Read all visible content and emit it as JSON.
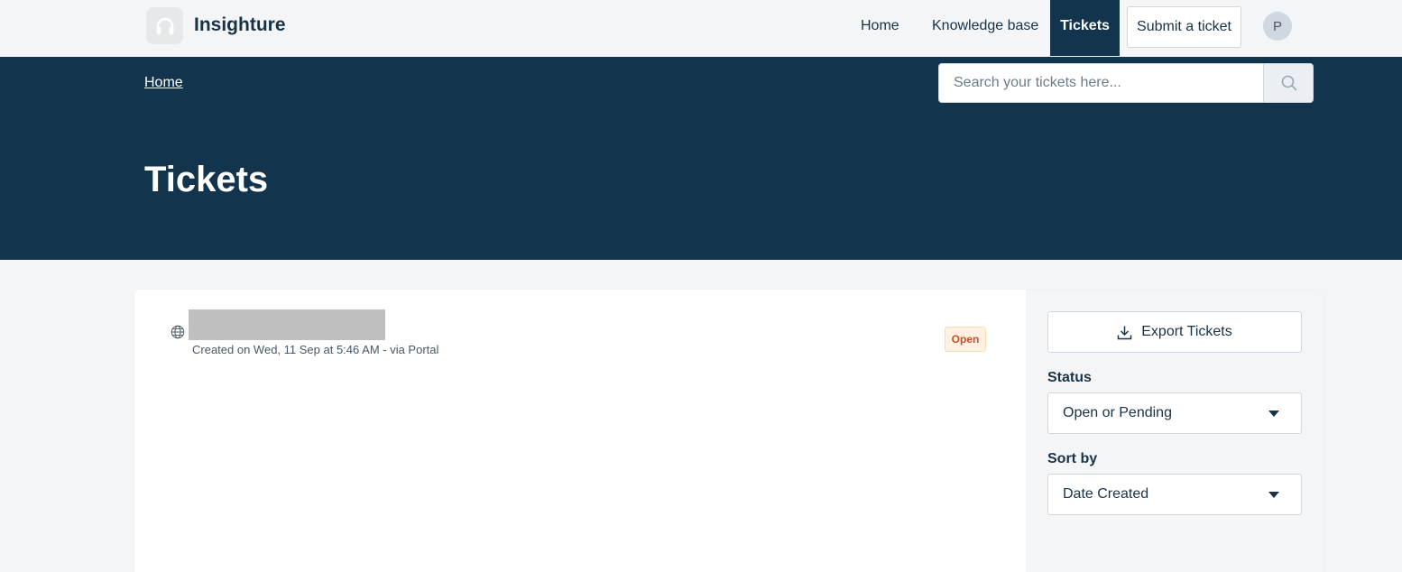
{
  "header": {
    "brand": "Insighture",
    "nav": {
      "home": "Home",
      "knowledge_base": "Knowledge base",
      "tickets": "Tickets"
    },
    "submit_label": "Submit a ticket",
    "avatar_initial": "P"
  },
  "hero": {
    "breadcrumb": "Home",
    "search_placeholder": "Search your tickets here...",
    "title": "Tickets"
  },
  "tickets": [
    {
      "meta": "Created on Wed, 11 Sep at 5:46 AM - via Portal",
      "status": "Open"
    }
  ],
  "sidebar": {
    "export_label": "Export Tickets",
    "status_label": "Status",
    "status_value": "Open or Pending",
    "sort_label": "Sort by",
    "sort_value": "Date Created"
  },
  "colors": {
    "hero_bg": "#12344d",
    "badge_text": "#c7502e",
    "badge_bg": "#fef1e1"
  }
}
